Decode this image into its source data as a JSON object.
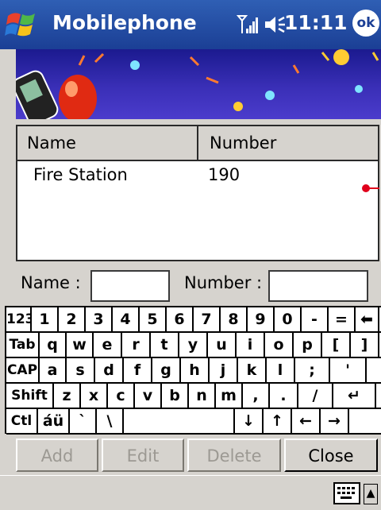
{
  "titlebar": {
    "start_icon": "windows-flag-icon",
    "title": "Mobilephone",
    "signal_icon": "signal-strength-icon",
    "volume_icon": "speaker-icon",
    "time": "11:11",
    "ok_label": "ok"
  },
  "banner": {
    "icon": "mobile-phone-balloon-banner"
  },
  "list": {
    "columns": [
      "Name",
      "Number"
    ],
    "rows": [
      {
        "name": "Fire Station",
        "number": "190"
      }
    ]
  },
  "form": {
    "name_label": "Name :",
    "name_value": "",
    "number_label": "Number :",
    "number_value": ""
  },
  "keyboard": {
    "rows": [
      [
        "123",
        "1",
        "2",
        "3",
        "4",
        "5",
        "6",
        "7",
        "8",
        "9",
        "0",
        "-",
        "=",
        "⬅"
      ],
      [
        "Tab",
        "q",
        "w",
        "e",
        "r",
        "t",
        "y",
        "u",
        "i",
        "o",
        "p",
        "[",
        "]"
      ],
      [
        "CAP",
        "a",
        "s",
        "d",
        "f",
        "g",
        "h",
        "j",
        "k",
        "l",
        ";",
        "'"
      ],
      [
        "Shift",
        "z",
        "x",
        "c",
        "v",
        "b",
        "n",
        "m",
        ",",
        ".",
        "/",
        "↵"
      ],
      [
        "Ctl",
        "áü",
        "`",
        "\\",
        " ",
        "↓",
        "↑",
        "←",
        "→"
      ]
    ]
  },
  "buttons": {
    "add": "Add",
    "edit": "Edit",
    "delete": "Delete",
    "close": "Close"
  },
  "bottombar": {
    "keyboard_icon": "keyboard-icon",
    "menu_arrow": "▲"
  },
  "colors": {
    "titlebar": "#2f5fb4",
    "chrome": "#d6d3ce",
    "accent_dot": "#e0001b"
  }
}
